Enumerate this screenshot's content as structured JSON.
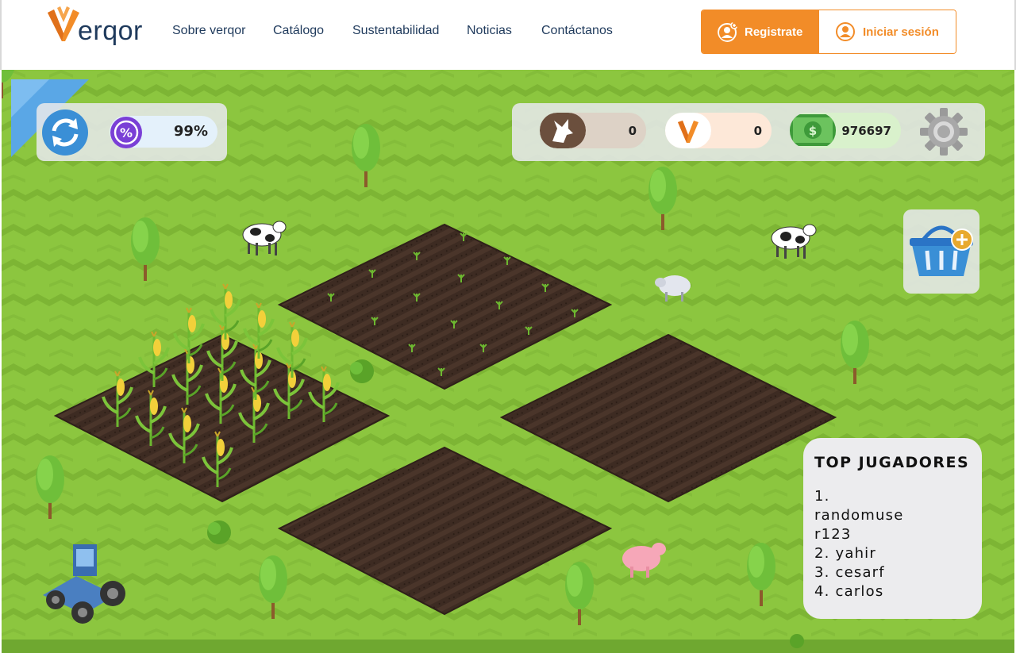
{
  "brand": {
    "name": "verqor",
    "logo_text": "erqor"
  },
  "nav": {
    "links": [
      "Sobre verqor",
      "Catálogo",
      "Sustentabilidad",
      "Noticias",
      "Contáctanos"
    ],
    "register_label": "Registrate",
    "login_label": "Iniciar sesión"
  },
  "hud": {
    "progress_percent": "99%",
    "wolf_count": "0",
    "verqor_count": "0",
    "money": "976697"
  },
  "leaderboard": {
    "title": "TOP JUGADORES",
    "entries": [
      "1. randomuse r123",
      "2. yahir",
      "3. cesarf",
      "4. carlos"
    ]
  },
  "icons": {
    "refresh": "refresh-icon",
    "percent": "percent-icon",
    "wolf": "wolf-icon",
    "verqor": "verqor-logo-icon",
    "money": "money-bill-icon",
    "settings": "gear-icon",
    "basket": "basket-add-icon"
  },
  "colors": {
    "accent": "#f28c28",
    "navy": "#1f3a5c",
    "grass": "#8cc63f",
    "soil": "#3d2b22"
  }
}
